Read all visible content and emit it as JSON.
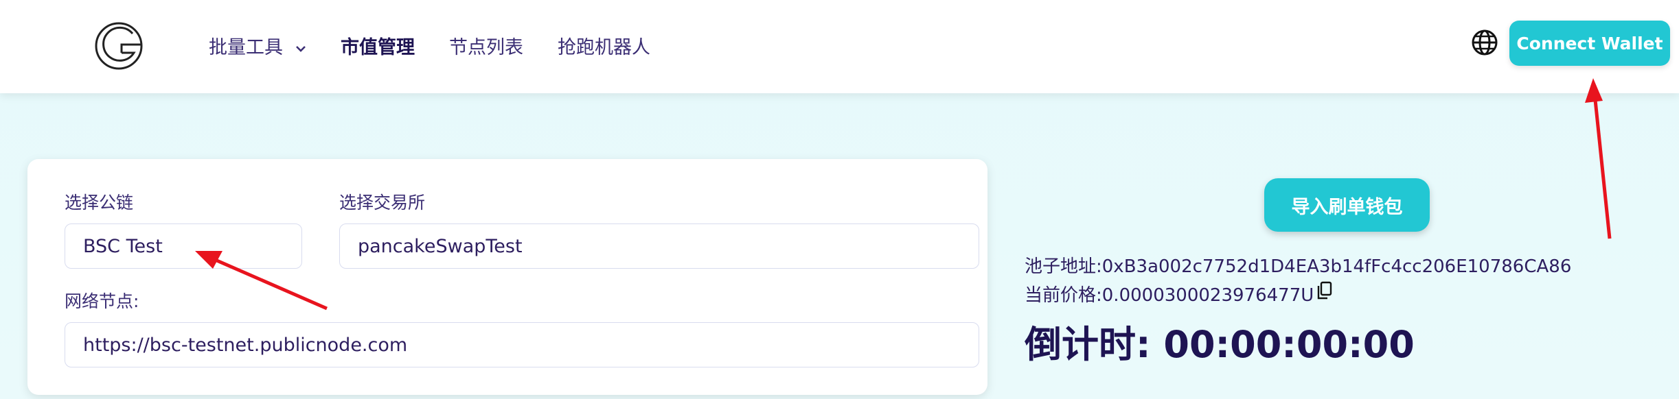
{
  "header": {
    "nav": [
      {
        "label": "批量工具",
        "has_dropdown": true,
        "active": false
      },
      {
        "label": "市值管理",
        "active": true
      },
      {
        "label": "节点列表",
        "active": false
      },
      {
        "label": "抢跑机器人",
        "active": false
      }
    ],
    "globe_icon": "globe-icon",
    "connect_label": "Connect Wallet"
  },
  "form": {
    "chain_label": "选择公链",
    "chain_value": "BSC Test",
    "exchange_label": "选择交易所",
    "exchange_value": "pancakeSwapTest",
    "node_label": "网络节点:",
    "node_value": "https://bsc-testnet.publicnode.com"
  },
  "panel": {
    "import_label": "导入刷单钱包",
    "pool_address": "池子地址:0xB3a002c7752d1D4EA3b14fFc4cc206E10786CA86",
    "current_price": "当前价格:0.0000300023976477U",
    "countdown": "倒计时: 00:00:00:00"
  },
  "colors": {
    "accent": "#22c7d3",
    "text": "#2d1e5f",
    "arrow": "#e8141e",
    "background": "#e6f9fb"
  }
}
